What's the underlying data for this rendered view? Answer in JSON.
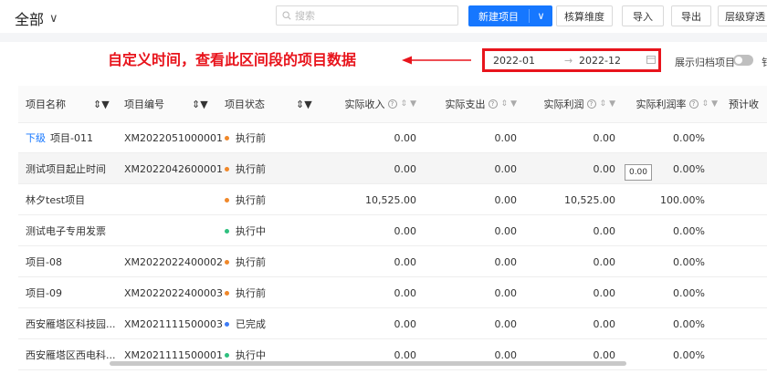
{
  "toolbar": {
    "scope_label": "全部",
    "search_placeholder": "搜索",
    "new_project": "新建项目",
    "accounting_dims": "核算维度",
    "import": "导入",
    "export": "导出",
    "drill": "层级穿透"
  },
  "annotation": {
    "text": "自定义时间，查看此区间段的项目数据"
  },
  "filter": {
    "start": "2022-01",
    "separator": "→",
    "end": "2022-12",
    "archive_toggle_label": "展示归档项目",
    "cut_text": "钅"
  },
  "columns": [
    "项目名称",
    "项目编号",
    "项目状态",
    "实际收入",
    "实际支出",
    "实际利润",
    "实际利润率",
    "预计收"
  ],
  "rows": [
    {
      "prefix": "下级",
      "name": "项目-011",
      "code": "XM2022051000001",
      "status": "执行前",
      "status_color": "#f0882a",
      "income": "0.00",
      "expense": "0.00",
      "profit": "0.00",
      "rate": "0.00%"
    },
    {
      "prefix": "",
      "name": "测试项目起止时间",
      "code": "XM2022042600001",
      "status": "执行前",
      "status_color": "#f0882a",
      "income": "0.00",
      "expense": "0.00",
      "profit": "0.00",
      "rate": "0.00%"
    },
    {
      "prefix": "",
      "name": "林夕test项目",
      "code": "",
      "status": "执行前",
      "status_color": "#f0882a",
      "income": "10,525.00",
      "expense": "0.00",
      "profit": "10,525.00",
      "rate": "100.00%"
    },
    {
      "prefix": "",
      "name": "测试电子专用发票",
      "code": "",
      "status": "执行中",
      "status_color": "#2fc07f",
      "income": "0.00",
      "expense": "0.00",
      "profit": "0.00",
      "rate": "0.00%"
    },
    {
      "prefix": "",
      "name": "项目-08",
      "code": "XM2022022400002",
      "status": "执行前",
      "status_color": "#f0882a",
      "income": "0.00",
      "expense": "0.00",
      "profit": "0.00",
      "rate": "0.00%"
    },
    {
      "prefix": "",
      "name": "项目-09",
      "code": "XM2022022400003",
      "status": "执行前",
      "status_color": "#f0882a",
      "income": "0.00",
      "expense": "0.00",
      "profit": "0.00",
      "rate": "0.00%"
    },
    {
      "prefix": "",
      "name": "西安雁塔区科技园...",
      "code": "XM2021111500003",
      "status": "已完成",
      "status_color": "#3d7bf5",
      "income": "0.00",
      "expense": "0.00",
      "profit": "0.00",
      "rate": "0.00%"
    },
    {
      "prefix": "",
      "name": "西安雁塔区西电科...",
      "code": "XM2021111500001",
      "status": "执行中",
      "status_color": "#2fc07f",
      "income": "0.00",
      "expense": "0.00",
      "profit": "0.00",
      "rate": "0.00%"
    }
  ],
  "tooltip": {
    "text": "0.00"
  },
  "colors": {
    "accent": "#1677ff",
    "annotation": "#e8141c"
  }
}
